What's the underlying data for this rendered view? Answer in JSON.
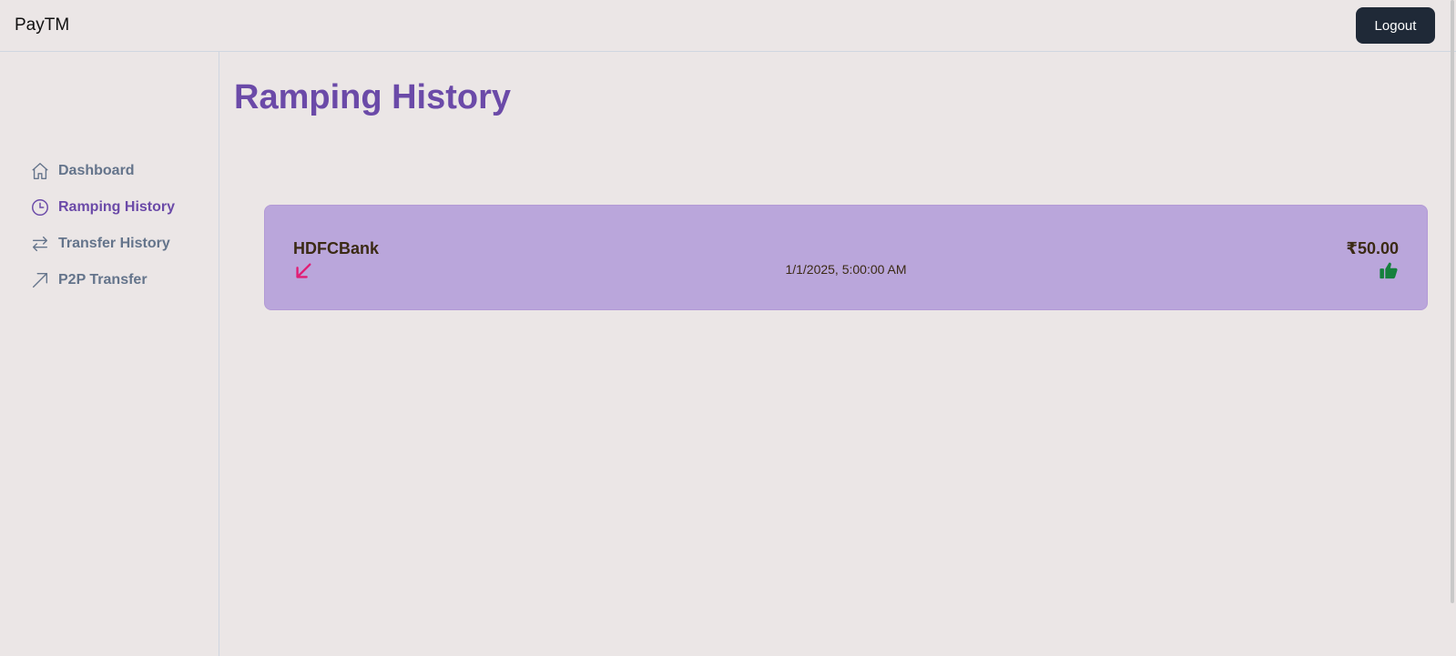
{
  "header": {
    "brand": "PayTM",
    "logout_label": "Logout"
  },
  "sidebar": {
    "items": [
      {
        "label": "Dashboard",
        "icon": "home-icon",
        "active": false
      },
      {
        "label": "Ramping History",
        "icon": "clock-icon",
        "active": true
      },
      {
        "label": "Transfer History",
        "icon": "transfer-arrows-icon",
        "active": false
      },
      {
        "label": "P2P Transfer",
        "icon": "arrow-up-right-icon",
        "active": false
      }
    ]
  },
  "main": {
    "title": "Ramping History",
    "transactions": [
      {
        "provider": "HDFCBank",
        "datetime": "1/1/2025, 5:00:00 AM",
        "amount": "₹50.00",
        "direction_icon": "arrow-down-left-icon",
        "status_icon": "thumbs-up-icon"
      }
    ]
  },
  "colors": {
    "accent": "#6b4aa8",
    "card_background": "#baa6db",
    "inbound_arrow": "#e11d74",
    "status_success": "#15803d",
    "logout_button": "#1f2937"
  }
}
